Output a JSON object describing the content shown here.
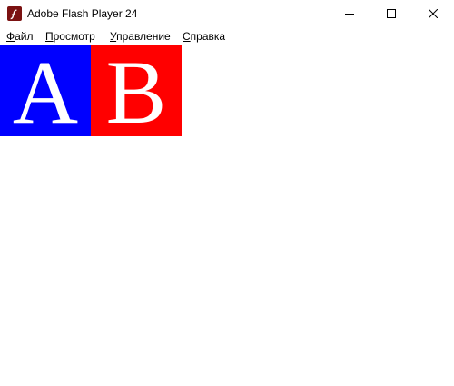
{
  "window": {
    "title": "Adobe Flash Player 24",
    "icon": "flash-player-icon"
  },
  "menubar": {
    "items": [
      {
        "accel": "Ф",
        "rest": "айл"
      },
      {
        "accel": "П",
        "rest": "росмотр"
      },
      {
        "accel": "У",
        "rest": "правление"
      },
      {
        "accel": "С",
        "rest": "правка"
      }
    ]
  },
  "stage": {
    "tiles": [
      {
        "letter": "A",
        "color": "#0000ff"
      },
      {
        "letter": "B",
        "color": "#ff0000"
      }
    ],
    "text_color": "#ffffff",
    "background": "#ffffff"
  }
}
